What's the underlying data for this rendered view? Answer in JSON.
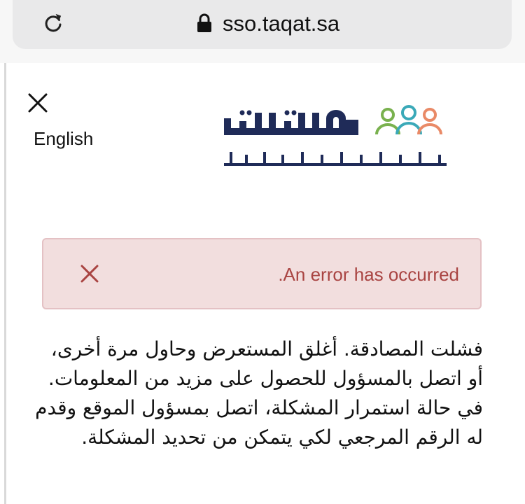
{
  "browser": {
    "url": "sso.taqat.sa",
    "reload_icon": "reload-icon",
    "lock_icon": "lock-icon"
  },
  "header": {
    "close_icon": "close-icon",
    "language_link": "English",
    "logo": {
      "title": "طاقات",
      "subtitle": "البوابة الوطنية للعمل",
      "colors": {
        "navy": "#1f2b58",
        "green": "#79b14e",
        "teal": "#3aa9b8",
        "coral": "#e98a67"
      }
    }
  },
  "alert": {
    "message": ".An error has occurred",
    "close_icon": "close-icon",
    "colors": {
      "background": "#f2dede",
      "border": "#e4c1c4",
      "text": "#a94442"
    }
  },
  "content": {
    "paragraph_1": "فشلت المصادقة. أغلق المستعرض وحاول مرة أخرى، أو اتصل بالمسؤول للحصول على مزيد من المعلومات.",
    "paragraph_2": "في حالة استمرار المشكلة، اتصل بمسؤول الموقع وقدم له الرقم المرجعي لكي يتمكن من تحديد المشكلة."
  }
}
